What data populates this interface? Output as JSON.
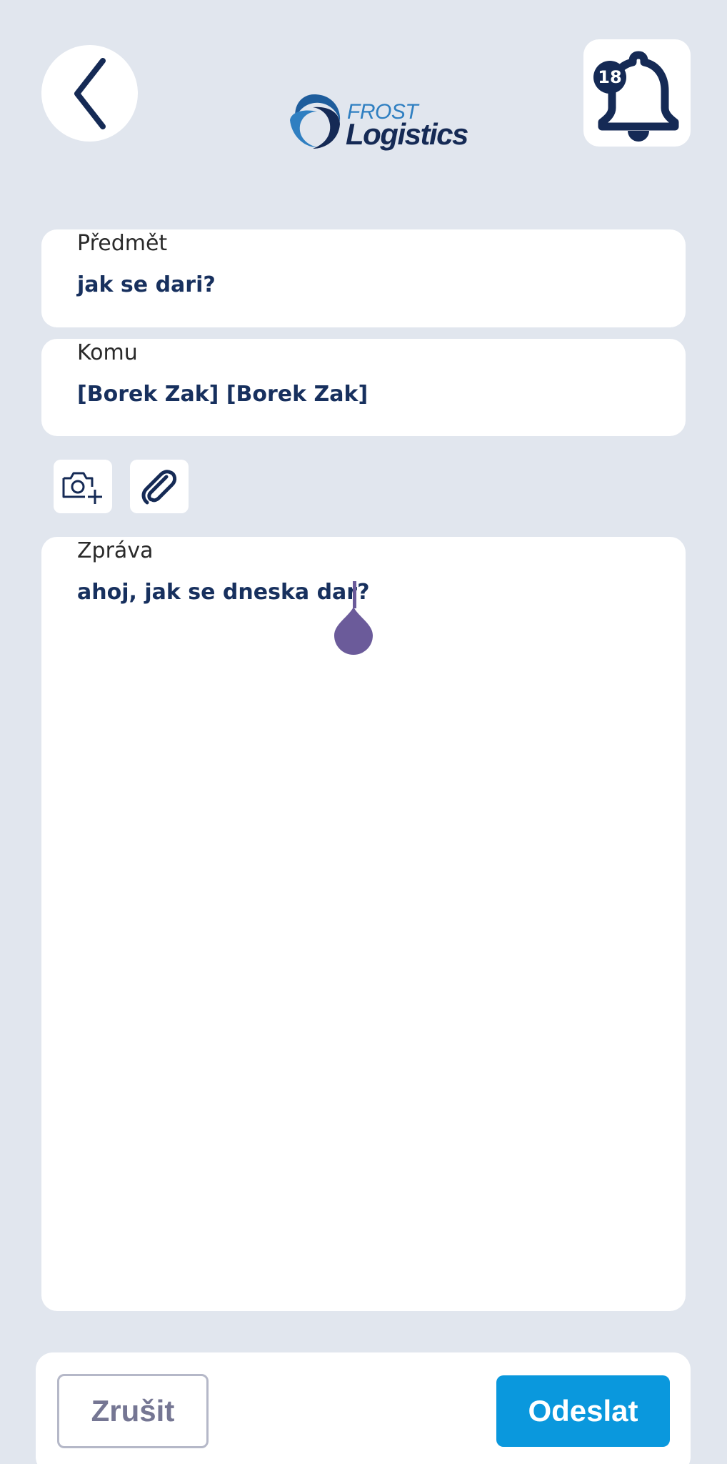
{
  "header": {
    "logo": {
      "line1": "FROST",
      "line2": "Logistics"
    },
    "notifications": {
      "count": "18"
    },
    "icons": {
      "back": "chevron-left-icon",
      "bell": "bell-icon"
    }
  },
  "form": {
    "subject": {
      "label": "Předmět",
      "value": "jak se dari?"
    },
    "recipient": {
      "label": "Komu",
      "value": "[Borek Zak] [Borek Zak]"
    },
    "message": {
      "label": "Zpráva",
      "value": "ahoj, jak se dneska dar?"
    },
    "tools": {
      "camera_icon": "camera-plus-icon",
      "attach_icon": "paperclip-icon"
    }
  },
  "actions": {
    "cancel_label": "Zrušit",
    "send_label": "Odeslat"
  },
  "colors": {
    "background": "#e1e6ee",
    "navy": "#152a55",
    "text_value": "#17305e",
    "send_button": "#0a98dd",
    "cancel_text": "#757693",
    "caret": "#6b5b9a"
  }
}
